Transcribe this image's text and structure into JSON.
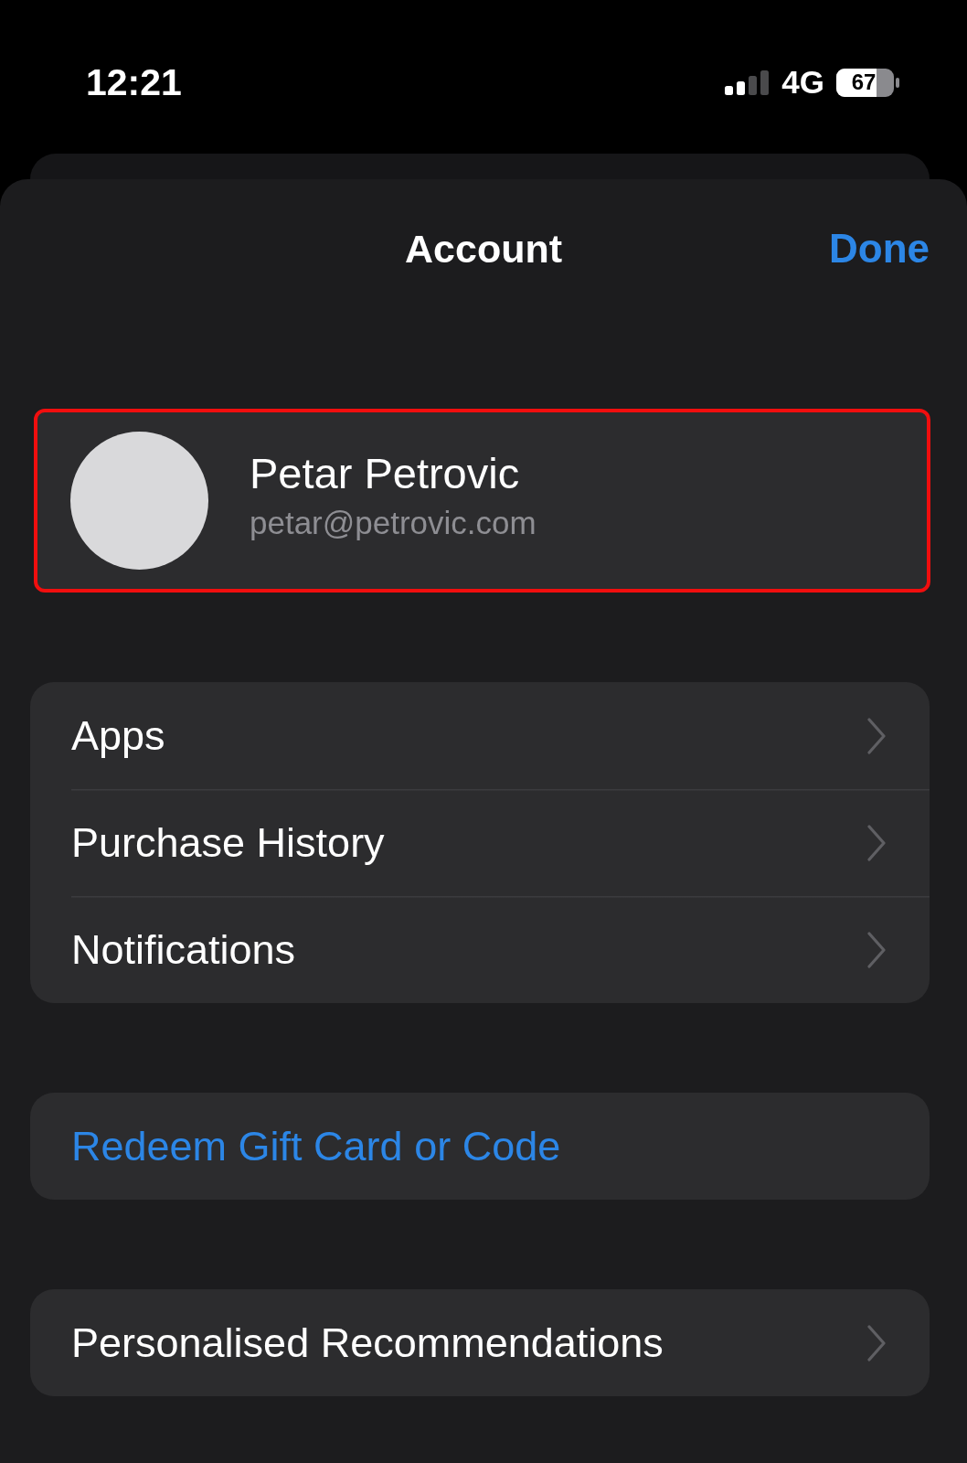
{
  "status_bar": {
    "time": "12:21",
    "network": "4G",
    "battery": "67"
  },
  "header": {
    "title": "Account",
    "done_button": "Done"
  },
  "profile": {
    "name": "Petar Petrovic",
    "email": "petar@petrovic.com",
    "highlighted": true
  },
  "groups": [
    {
      "items": [
        {
          "label": "Apps",
          "kind": "link"
        },
        {
          "label": "Purchase History",
          "kind": "link"
        },
        {
          "label": "Notifications",
          "kind": "link"
        }
      ]
    },
    {
      "items": [
        {
          "label": "Redeem Gift Card or Code",
          "kind": "action"
        }
      ]
    },
    {
      "items": [
        {
          "label": "Personalised Recommendations",
          "kind": "link"
        }
      ]
    }
  ]
}
